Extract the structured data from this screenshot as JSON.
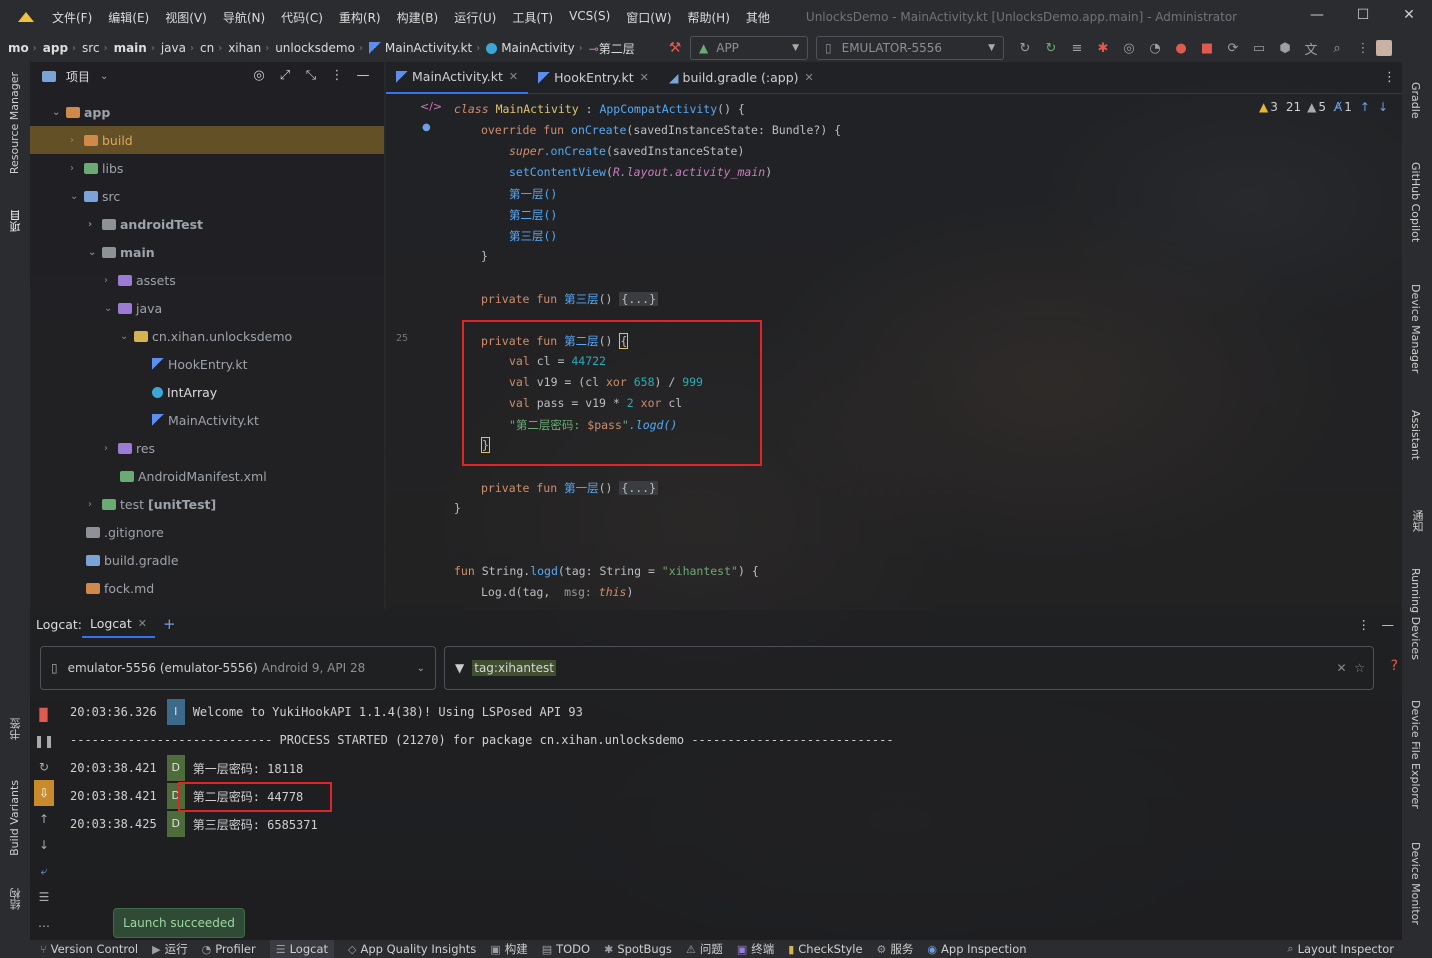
{
  "titlebar": {
    "menu": [
      "文件(F)",
      "编辑(E)",
      "视图(V)",
      "导航(N)",
      "代码(C)",
      "重构(R)",
      "构建(B)",
      "运行(U)",
      "工具(T)",
      "VCS(S)",
      "窗口(W)",
      "帮助(H)",
      "其他"
    ],
    "window_title": "UnlocksDemo - MainActivity.kt [UnlocksDemo.app.main] - Administrator",
    "minimize": "—",
    "maximize": "☐",
    "close": "✕"
  },
  "breadcrumb": {
    "items": [
      "mo",
      "app",
      "src",
      "main",
      "java",
      "cn",
      "xihan",
      "unlocksdemo",
      "MainActivity.kt",
      "MainActivity",
      "第二层"
    ],
    "run_config": "APP",
    "device": "EMULATOR-5556"
  },
  "left_stripe": {
    "resource_manager": "Resource Manager",
    "project": "项目",
    "bookmarks": "书签",
    "build_variants": "Build Variants",
    "structure": "结构"
  },
  "project_panel": {
    "title": "项目",
    "tree": [
      {
        "label": "app",
        "bold": true
      },
      {
        "label": "build",
        "bold": false
      },
      {
        "label": "libs",
        "bold": false
      },
      {
        "label": "src",
        "bold": false
      },
      {
        "label": "androidTest",
        "bold": true
      },
      {
        "label": "main",
        "bold": true
      },
      {
        "label": "assets",
        "bold": false
      },
      {
        "label": "java",
        "bold": false
      },
      {
        "label": "cn.xihan.unlocksdemo",
        "bold": false
      },
      {
        "label": "HookEntry.kt",
        "bold": false
      },
      {
        "label": "IntArray",
        "bold": false
      },
      {
        "label": "MainActivity.kt",
        "bold": false
      },
      {
        "label": "res",
        "bold": false
      },
      {
        "label": "AndroidManifest.xml",
        "bold": false
      },
      {
        "label": "test",
        "extra": "[unitTest]",
        "bold": false
      },
      {
        "label": ".gitignore",
        "bold": false
      },
      {
        "label": "build.gradle",
        "bold": false
      },
      {
        "label": "fock.md",
        "bold": false
      }
    ]
  },
  "editor": {
    "tabs": [
      {
        "label": "MainActivity.kt",
        "active": true
      },
      {
        "label": "HookEntry.kt",
        "active": false
      },
      {
        "label": "build.gradle (:app)",
        "active": false
      }
    ],
    "inspection": {
      "warnings": "3",
      "weak": "21",
      "typos": "5",
      "other": "1"
    },
    "line_number": "25",
    "code": {
      "class_kw": "class",
      "class_name": "MainActivity",
      "superclass": "AppCompatActivity",
      "override_line": {
        "kw": "override fun",
        "fn": "onCreate",
        "param": "savedInstanceState",
        "type": "Bundle?"
      },
      "super_call": "super",
      "super_fn": ".onCreate",
      "super_arg": "(savedInstanceState)",
      "setcontent_fn": "setContentView",
      "setcontent_arg": "R.layout.activity_main",
      "call1": "第一层()",
      "call2": "第二层()",
      "call3": "第三层()",
      "private_fun": "private fun",
      "fn3": "第三层",
      "fn2": "第二层",
      "fn1": "第一层",
      "folded": "{...}",
      "val_kw": "val",
      "cl_name": "cl",
      "cl_val": "44722",
      "v19_name": "v19",
      "v19_expr_a": "(cl",
      "xor": "xor",
      "n658": "658",
      "n999": "999",
      "pass_name": "pass",
      "pass_expr": "v19",
      "n2": "2",
      "pass_str": "\"第二层密码: ",
      "pass_tpl": "$pass",
      "pass_end": "\"",
      "logd_call": ".logd()",
      "ext_fun": "fun",
      "ext_recv": "String.",
      "ext_name": "logd",
      "ext_param": "tag",
      "ext_type": "String",
      "ext_default": "\"xihantest\"",
      "log_d": "Log.d",
      "log_tag": "tag",
      "log_msg": "msg:",
      "log_this": "this"
    }
  },
  "right_stripe": {
    "gradle": "Gradle",
    "copilot": "GitHub Copilot",
    "device_manager": "Device Manager",
    "assistant": "Assistant",
    "notifications": "通知",
    "running_devices": "Running Devices",
    "file_explorer": "Device File Explorer",
    "device_monitor": "Device Monitor"
  },
  "logcat": {
    "label": "Logcat:",
    "tab": "Logcat",
    "device": "emulator-5556 (emulator-5556)",
    "device_api": "Android 9, API 28",
    "filter": "tag:xihantest",
    "rows": [
      {
        "time": "20:03:36.326",
        "level": "I",
        "msg": "Welcome to YukiHookAPI 1.1.4(38)! Using LSPosed API 93"
      },
      {
        "time": "",
        "level": "",
        "msg": "---------------------------- PROCESS STARTED (21270) for package cn.xihan.unlocksdemo ----------------------------"
      },
      {
        "time": "20:03:38.421",
        "level": "D",
        "msg": "第一层密码: 18118"
      },
      {
        "time": "20:03:38.421",
        "level": "D",
        "msg": "第二层密码: 44778"
      },
      {
        "time": "20:03:38.425",
        "level": "D",
        "msg": "第三层密码: 6585371"
      }
    ],
    "toast": "Launch succeeded"
  },
  "statusbar": {
    "items": [
      "Version Control",
      "运行",
      "Profiler",
      "Logcat",
      "App Quality Insights",
      "构建",
      "TODO",
      "SpotBugs",
      "问题",
      "终端",
      "CheckStyle",
      "服务",
      "App Inspection"
    ],
    "right": "Layout Inspector"
  },
  "colors": {
    "accent": "#3574f0",
    "highlight_box": "#e0242a",
    "keyword": "#cf8e6d",
    "function": "#56a8f5"
  }
}
